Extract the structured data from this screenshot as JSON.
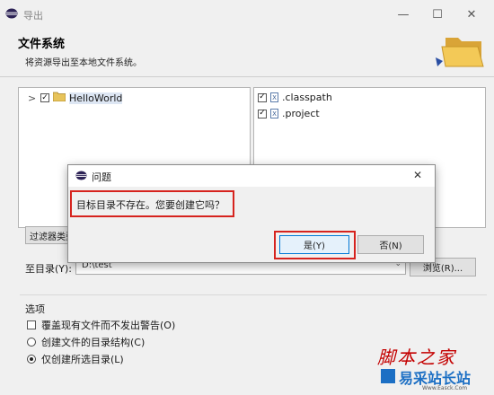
{
  "window": {
    "title": "导出",
    "minimize_glyph": "—",
    "maximize_glyph": "☐",
    "close_glyph": "✕"
  },
  "page": {
    "title": "文件系统",
    "description": "将资源导出至本地文件系统。"
  },
  "project_tree": {
    "items": [
      {
        "label": "HelloWorld",
        "checked": true,
        "expand_glyph": ">"
      }
    ]
  },
  "file_list": {
    "items": [
      {
        "label": ".classpath",
        "checked": true
      },
      {
        "label": ".project",
        "checked": true
      }
    ]
  },
  "filter_button": {
    "label": "过滤器类型"
  },
  "destination": {
    "label": "至目录(Y):",
    "value": "D:\\test",
    "browse_label": "浏览(R)..."
  },
  "options": {
    "group_label": "选项",
    "overwrite_label": "覆盖现有文件而不发出警告(O)",
    "create_structure_label": "创建文件的目录结构(C)",
    "create_selected_label": "仅创建所选目录(L)"
  },
  "dialog": {
    "title": "问题",
    "message": "目标目录不存在。您要创建它吗？",
    "yes_label": "是(Y)",
    "no_label": "否(N)",
    "close_glyph": "✕"
  },
  "watermark": {
    "line1": "脚本之家",
    "line2": "易采站长站",
    "line3": "Www.Easck.Com"
  },
  "colors": {
    "highlight_red": "#d6231e",
    "primary_button_border": "#0078d7",
    "watermark_red": "#c40000"
  }
}
